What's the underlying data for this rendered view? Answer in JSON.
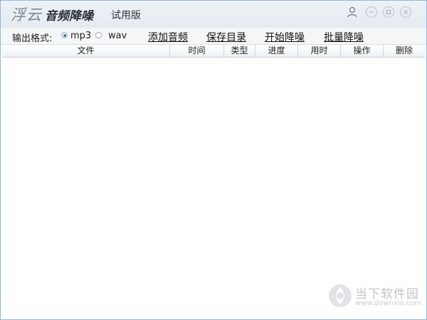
{
  "titlebar": {
    "brand": "浮云",
    "product": "音频降噪",
    "edition": "试用版"
  },
  "toolbar": {
    "format_label": "输出格式:",
    "formats": [
      {
        "label": "mp3",
        "selected": true
      },
      {
        "label": "wav",
        "selected": false
      }
    ],
    "actions": [
      "添加音频",
      "保存目录",
      "开始降噪",
      "批量降噪"
    ]
  },
  "table": {
    "columns": [
      "文件",
      "时间",
      "类型",
      "进度",
      "用时",
      "操作",
      "删除"
    ],
    "rows": []
  },
  "watermark": {
    "name": "当下软件园",
    "url": "www.downxia.com"
  },
  "colors": {
    "window_border": "#8fb6dc",
    "radio_accent": "#2b6cc4"
  }
}
